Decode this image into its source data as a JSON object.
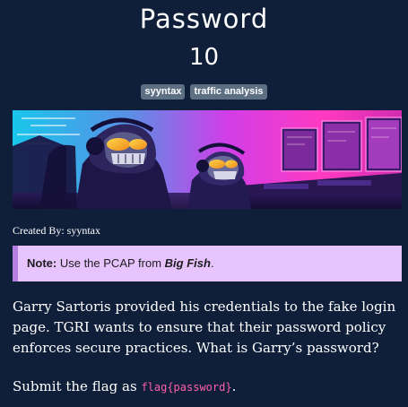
{
  "challenge": {
    "title": "Password",
    "points": "10",
    "tags": [
      "syyntax",
      "traffic analysis"
    ],
    "created_by_label": "Created By:",
    "author": "syyntax"
  },
  "note": {
    "label": "Note:",
    "text_before": "Use the PCAP from",
    "emphasis": "Big Fish",
    "text_after": "."
  },
  "description": "Garry Sartoris provided his credentials to the fake login page. TGRI wants to ensure that their password policy enforces secure practices. What is Garry’s password?",
  "submit": {
    "text_before": "Submit the flag as",
    "flag_format": "flag{password}",
    "text_after": "."
  },
  "colors": {
    "background": "#0f1f3a",
    "tag_background": "#5d6f83",
    "note_background": "#e8c4ff",
    "note_border": "#b47fe0",
    "code_color": "#ff5fa8"
  },
  "banner": {
    "icon": "cyber-hackers-illustration"
  }
}
